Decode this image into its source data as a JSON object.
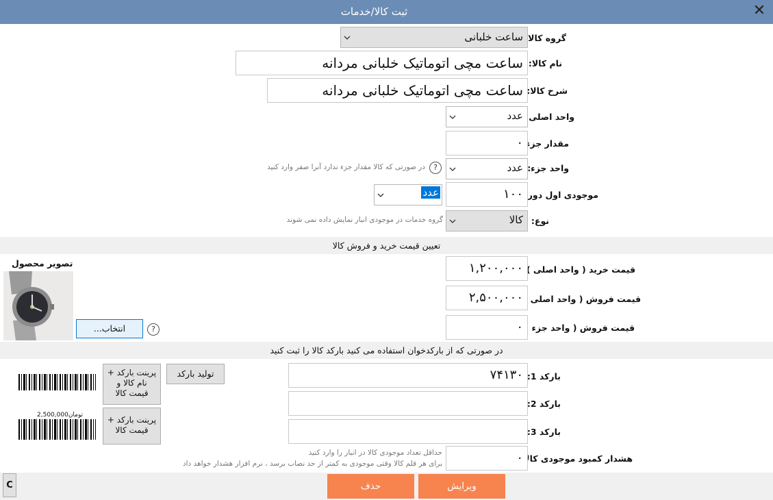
{
  "window": {
    "title": "ثبت کالا/خدمات",
    "close": "✕"
  },
  "fields": {
    "group": {
      "label": "گروه کالا:",
      "value": "ساعت خلبانی"
    },
    "name": {
      "label": "نام کالا:",
      "value": "ساعت مچی اتوماتیک خلبانی مردانه"
    },
    "description": {
      "label": "شرح کالا:",
      "value": "ساعت مچی اتوماتیک خلبانی مردانه"
    },
    "main_unit": {
      "label": "واحد اصلی:",
      "value": "عدد"
    },
    "part_amount": {
      "label": "مقدار جزء:",
      "value": "۰"
    },
    "part_unit": {
      "label": "واحد جزء:",
      "value": "عدد",
      "hint": "در صورتی که کالا مقدار جزء ندارد آنرا صفر وارد کنید"
    },
    "opening_stock": {
      "label": "موجودی اول دوره:",
      "value": "۱۰۰",
      "unit": "عدد"
    },
    "type": {
      "label": "نوع:",
      "value": "کالا",
      "hint": "گروه خدمات در موجودی انبار نمایش داده نمی شوند"
    }
  },
  "pricing": {
    "section_title": "تعیین قیمت خرید و فروش کالا",
    "purchase": {
      "label": "قیمت خرید ( واحد اصلی ) :",
      "value": "۱,۲۰۰,۰۰۰"
    },
    "sale_main": {
      "label": "قیمت فروش ( واحد اصلی ) :",
      "value": "۲,۵۰۰,۰۰۰"
    },
    "sale_part": {
      "label": "قیمت فروش ( واحد جزء ) :",
      "value": "۰"
    }
  },
  "image": {
    "title": "تصویر محصول",
    "choose_button": "انتخاب..."
  },
  "barcode": {
    "section_title": "در صورتی که از بارکدخوان استفاده می کنید بارکد کالا را ثبت کنید",
    "b1": {
      "label": "بارکد 1:",
      "value": "۷۴۱۳۰"
    },
    "b2": {
      "label": "بارکد 2:",
      "value": ""
    },
    "b3": {
      "label": "بارکد 3:",
      "value": ""
    },
    "generate_button": "تولید بارکد",
    "print_name_price": "پرینت بارکد + نام کالا و قیمت کالا",
    "print_price": "پرینت بارکد + قیمت کالا",
    "preview_price": "2,500,000",
    "preview_currency": "تومان"
  },
  "low_stock": {
    "label": "هشدار کمبود موجودی کالا:",
    "value": "۰",
    "hint_line1": "حداقل تعداد موجودی کالا در انبار را وارد کنید",
    "hint_line2": "برای هر قلم کالا وقتی موجودی به کمتر از حد نصاب برسد ، نرم افزار هشدار خواهد داد"
  },
  "footer": {
    "edit_button": "ویرایش",
    "delete_button": "حذف",
    "c_button": "C"
  },
  "colors": {
    "titlebar": "#6b8cb4",
    "accent_button": "#f7834f",
    "selection": "#0078d7"
  }
}
